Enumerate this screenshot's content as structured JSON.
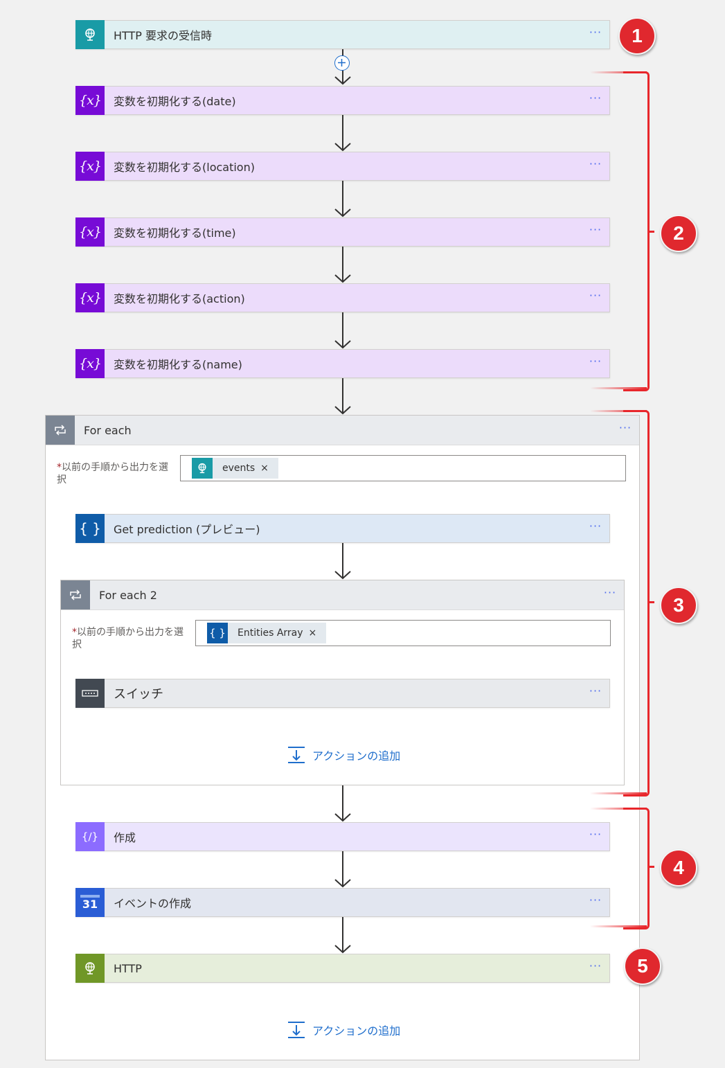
{
  "trigger": {
    "label": "HTTP 要求の受信時",
    "icon": "globe-icon",
    "more": "···"
  },
  "variables": [
    {
      "label": "変数を初期化する(date)",
      "icon": "variable-icon",
      "more": "···"
    },
    {
      "label": "変数を初期化する(location)",
      "icon": "variable-icon",
      "more": "···"
    },
    {
      "label": "変数を初期化する(time)",
      "icon": "variable-icon",
      "more": "···"
    },
    {
      "label": "変数を初期化する(action)",
      "icon": "variable-icon",
      "more": "···"
    },
    {
      "label": "変数を初期化する(name)",
      "icon": "variable-icon",
      "more": "···"
    }
  ],
  "variable_icon_text": "{x}",
  "foreach": {
    "title": "For each",
    "more": "···",
    "field_label": "以前の手順から出力を選択",
    "required_mark": "*",
    "token_label": "events",
    "token_remove": "×",
    "prediction": {
      "label": "Get prediction (プレビュー)",
      "icon_text": "{ }",
      "more": "···"
    },
    "foreach2": {
      "title": "For each 2",
      "more": "···",
      "field_label": "以前の手順から出力を選択",
      "required_mark": "*",
      "token_label": "Entities Array",
      "token_icon_text": "{ }",
      "token_remove": "×",
      "switch": {
        "label": "スイッチ",
        "more": "···"
      },
      "add_action": "アクションの追加"
    },
    "compose": {
      "label": "作成",
      "more": "···"
    },
    "event": {
      "label": "イベントの作成",
      "icon_text": "31",
      "more": "···"
    },
    "http": {
      "label": "HTTP",
      "more": "···"
    },
    "add_action": "アクションの追加"
  },
  "annotations": [
    "1",
    "2",
    "3",
    "4",
    "5"
  ],
  "colors": {
    "annotation_red": "#e0282e",
    "variable_purple": "#770bd6",
    "link_blue": "#1f6ecc"
  }
}
